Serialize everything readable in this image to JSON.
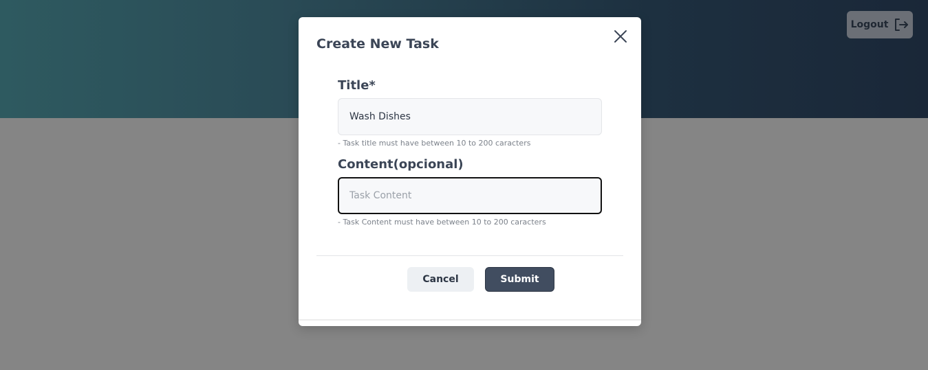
{
  "header": {
    "logout_label": "Logout"
  },
  "modal": {
    "title": "Create New Task",
    "fields": {
      "title": {
        "label": "Title*",
        "value": "Wash Dishes",
        "hint": "- Task title must have between 10 to 200 caracters"
      },
      "content": {
        "label": "Content(opcional)",
        "value": "",
        "placeholder": "Task Content",
        "hint": "- Task Content must have between 10 to 200 caracters"
      }
    },
    "buttons": {
      "cancel_label": "Cancel",
      "submit_label": "Submit"
    }
  },
  "icons": {
    "logout": "logout-icon",
    "close": "close-icon"
  },
  "colors": {
    "overlay": "#858585",
    "primary_button": "#414d60",
    "text_primary": "#3b4556"
  }
}
